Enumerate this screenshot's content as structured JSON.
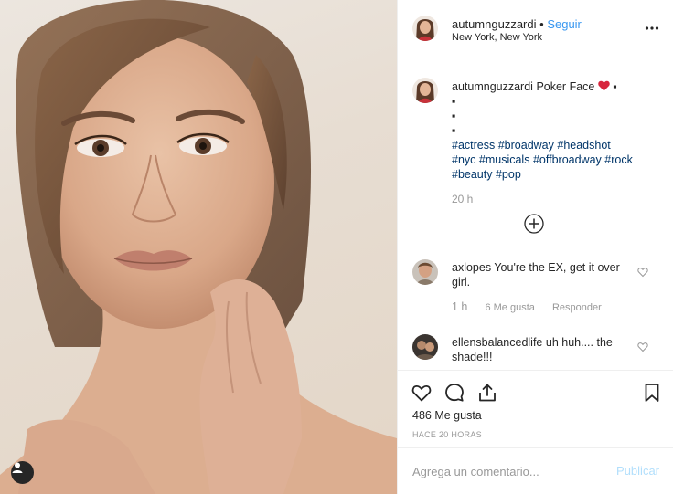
{
  "header": {
    "username": "autumnguzzardi",
    "separator": "•",
    "follow_label": "Seguir",
    "location": "New York, New York",
    "more_icon": "ellipsis-icon"
  },
  "caption": {
    "username": "autumnguzzardi",
    "text": "Poker Face",
    "emoji": "❤️",
    "bullet_lines": [
      "▪︎",
      "▪︎",
      "▪︎",
      "▪︎"
    ],
    "hashtags_line1": [
      "#actress",
      "#broadway",
      "#headshot"
    ],
    "hashtags_line2": [
      "#nyc",
      "#musicals",
      "#offbroadway",
      "#rock"
    ],
    "hashtags_line3": [
      "#beauty",
      "#pop"
    ],
    "time": "20 h"
  },
  "comments": [
    {
      "username": "axlopes",
      "text": "You're the EX, get it over girl.",
      "time": "1 h",
      "likes": "6 Me gusta",
      "reply": "Responder"
    },
    {
      "username": "ellensbalancedlife",
      "text": "uh huh.... the shade!!!"
    }
  ],
  "actions": {
    "likes": "486 Me gusta",
    "posted_ago": "HACE 20 HORAS"
  },
  "add_comment": {
    "placeholder": "Agrega un comentario...",
    "post_label": "Publicar"
  },
  "colors": {
    "link_blue": "#3897f0",
    "hashtag": "#003569",
    "muted": "#999999",
    "heart_red": "#ed4956",
    "post_disabled": "#b2dffc"
  }
}
